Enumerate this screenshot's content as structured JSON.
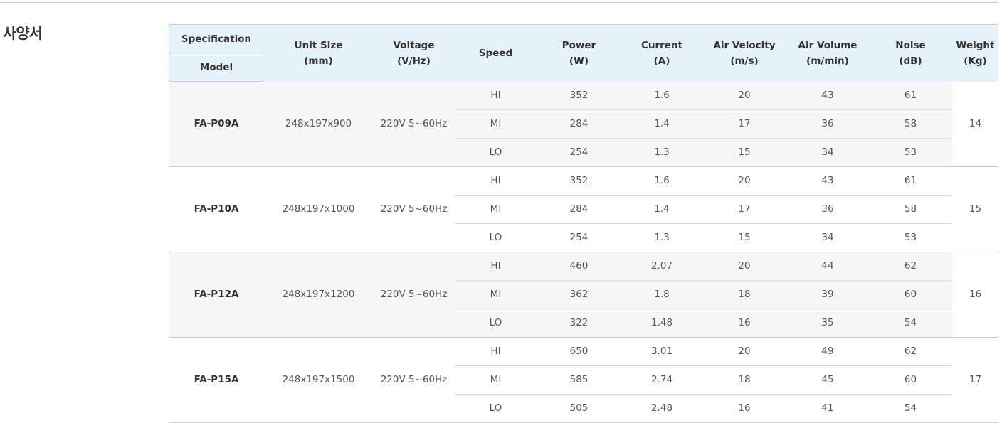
{
  "section": {
    "title": "사양서"
  },
  "headers": {
    "specification": "Specification",
    "model": "Model",
    "unit_size": [
      "Unit Size",
      "(mm)"
    ],
    "voltage": [
      "Voltage",
      "(V/Hz)"
    ],
    "speed": "Speed",
    "power": [
      "Power",
      "(W)"
    ],
    "current": [
      "Current",
      "(A)"
    ],
    "air_velocity": [
      "Air Velocity",
      "(m/s)"
    ],
    "air_volume": [
      "Air Volume",
      "(m/min)"
    ],
    "noise": [
      "Noise",
      "(dB)"
    ],
    "weight": [
      "Weight",
      "(Kg)"
    ]
  },
  "models": [
    {
      "model": "FA-P09A",
      "unit_size": "248x197x900",
      "voltage": "220V 5~60Hz",
      "weight": "14",
      "rows": [
        {
          "speed": "HI",
          "power": "352",
          "current": "1.6",
          "air_velocity": "20",
          "air_volume": "43",
          "noise": "61"
        },
        {
          "speed": "MI",
          "power": "284",
          "current": "1.4",
          "air_velocity": "17",
          "air_volume": "36",
          "noise": "58"
        },
        {
          "speed": "LO",
          "power": "254",
          "current": "1.3",
          "air_velocity": "15",
          "air_volume": "34",
          "noise": "53"
        }
      ]
    },
    {
      "model": "FA-P10A",
      "unit_size": "248x197x1000",
      "voltage": "220V 5~60Hz",
      "weight": "15",
      "rows": [
        {
          "speed": "HI",
          "power": "352",
          "current": "1.6",
          "air_velocity": "20",
          "air_volume": "43",
          "noise": "61"
        },
        {
          "speed": "MI",
          "power": "284",
          "current": "1.4",
          "air_velocity": "17",
          "air_volume": "36",
          "noise": "58"
        },
        {
          "speed": "LO",
          "power": "254",
          "current": "1.3",
          "air_velocity": "15",
          "air_volume": "34",
          "noise": "53"
        }
      ]
    },
    {
      "model": "FA-P12A",
      "unit_size": "248x197x1200",
      "voltage": "220V 5~60Hz",
      "weight": "16",
      "rows": [
        {
          "speed": "HI",
          "power": "460",
          "current": "2.07",
          "air_velocity": "20",
          "air_volume": "44",
          "noise": "62"
        },
        {
          "speed": "MI",
          "power": "362",
          "current": "1.8",
          "air_velocity": "18",
          "air_volume": "39",
          "noise": "60"
        },
        {
          "speed": "LO",
          "power": "322",
          "current": "1.48",
          "air_velocity": "16",
          "air_volume": "35",
          "noise": "54"
        }
      ]
    },
    {
      "model": "FA-P15A",
      "unit_size": "248x197x1500",
      "voltage": "220V 5~60Hz",
      "weight": "17",
      "rows": [
        {
          "speed": "HI",
          "power": "650",
          "current": "3.01",
          "air_velocity": "20",
          "air_volume": "49",
          "noise": "62"
        },
        {
          "speed": "MI",
          "power": "585",
          "current": "2.74",
          "air_velocity": "18",
          "air_volume": "45",
          "noise": "60"
        },
        {
          "speed": "LO",
          "power": "505",
          "current": "2.48",
          "air_velocity": "16",
          "air_volume": "41",
          "noise": "54"
        }
      ]
    }
  ]
}
